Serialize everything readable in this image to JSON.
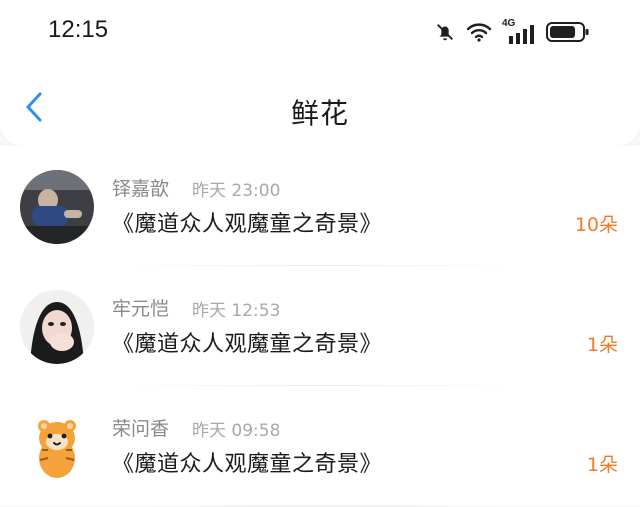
{
  "status_bar": {
    "time": "12:15",
    "network": "4G",
    "icons": [
      "mute-icon",
      "wifi-icon",
      "signal-icon",
      "battery-icon"
    ]
  },
  "header": {
    "title": "鲜花",
    "back_icon": "chevron-left-icon"
  },
  "accent_color": "#f07b2b",
  "records": [
    {
      "name": "铎嘉歆",
      "time": "昨天 23:00",
      "work": "《魔道众人观魔童之奇景》",
      "count": "10朵"
    },
    {
      "name": "牢元恺",
      "time": "昨天 12:53",
      "work": "《魔道众人观魔童之奇景》",
      "count": "1朵"
    },
    {
      "name": "荣问香",
      "time": "昨天 09:58",
      "work": "《魔道众人观魔童之奇景》",
      "count": "1朵"
    }
  ]
}
